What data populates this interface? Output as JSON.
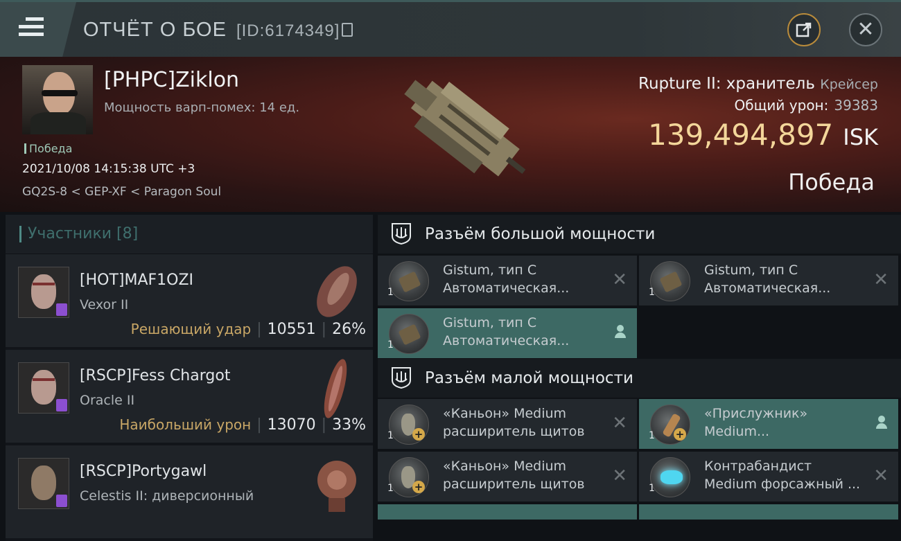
{
  "header": {
    "title": "ОТЧЁТ О БОЕ",
    "id_label": "[ID:6174349]"
  },
  "victim": {
    "name": "[PHPC]Ziklon",
    "warp_disrupt": "Мощность варп-помех: 14 ед.",
    "status_tag": "Победа",
    "datetime": "2021/10/08 14:15:38 UTC +3",
    "location": "GQ2S-8 < GEP-XF < Paragon Soul",
    "ship_name": "Rupture II: хранитель",
    "ship_class": "Крейсер",
    "total_damage_label": "Общий урон:",
    "total_damage": "39383",
    "isk_value": "139,494,897",
    "isk_unit": "ISK",
    "result": "Победа"
  },
  "participants": {
    "label": "Участники [8]",
    "items": [
      {
        "name": "[HOT]MAF1OZI",
        "ship": "Vexor II",
        "tag": "Решающий удар",
        "damage": "10551",
        "percent": "26%"
      },
      {
        "name": "[RSCP]Fess Chargot",
        "ship": "Oracle II",
        "tag": "Наибольший урон",
        "damage": "13070",
        "percent": "33%"
      },
      {
        "name": "[RSCP]Portygawl",
        "ship": "Celestis II: диверсионный",
        "tag": "",
        "damage": "",
        "percent": ""
      }
    ]
  },
  "fitting": {
    "high_slot_label": "Разъём большой мощности",
    "mid_slot_label": "Разъём малой мощности",
    "high_modules": [
      {
        "qty": "1",
        "line1": "Gistum, тип С",
        "line2": "Автоматическая..."
      },
      {
        "qty": "1",
        "line1": "Gistum, тип С",
        "line2": "Автоматическая..."
      },
      {
        "qty": "1",
        "line1": "Gistum, тип С",
        "line2": "Автоматическая..."
      }
    ],
    "mid_modules": [
      {
        "qty": "1",
        "line1": "«Каньон» Medium",
        "line2": "расширитель щитов"
      },
      {
        "qty": "1",
        "line1": "«Прислужник»",
        "line2": "Medium..."
      },
      {
        "qty": "1",
        "line1": "«Каньон» Medium",
        "line2": "расширитель щитов"
      },
      {
        "qty": "1",
        "line1": "Контрабандист",
        "line2": "Medium форсажный ..."
      }
    ]
  },
  "colors": {
    "accent_teal": "#3d6964",
    "isk_gold": "#f3d69a",
    "tag_gold": "#c9a766"
  }
}
